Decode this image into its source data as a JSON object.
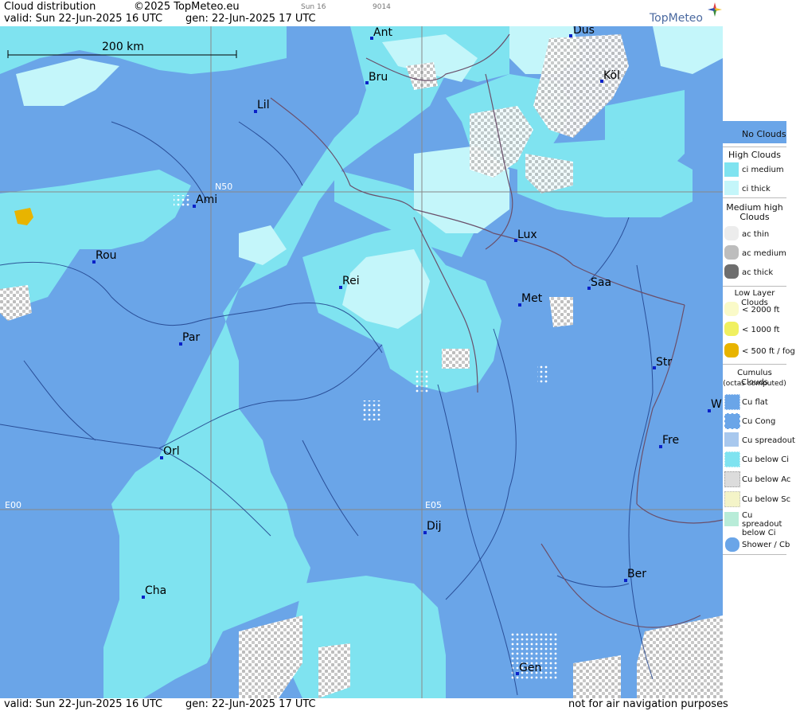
{
  "header": {
    "title": "Cloud distribution",
    "copyright": "©2025 TopMeteo.eu",
    "run_label": "Sun 16",
    "code": "9014",
    "valid": "valid:  Sun  22-Jun-2025  16 UTC",
    "gen": "gen: 22-Jun-2025 17 UTC",
    "brand": "TopMeteo"
  },
  "footer": {
    "valid": "valid:  Sun  22-Jun-2025  16 UTC",
    "gen": "gen: 22-Jun-2025 17 UTC",
    "disclaimer": "not for air navigation purposes"
  },
  "map": {
    "scale_label": "200 km",
    "coords": {
      "n50": "N50",
      "e00": "E00",
      "e05": "E05"
    },
    "cities": [
      {
        "name": "Ant"
      },
      {
        "name": "Düs"
      },
      {
        "name": "Bru"
      },
      {
        "name": "Köl"
      },
      {
        "name": "Lil"
      },
      {
        "name": "Ami"
      },
      {
        "name": "Lux"
      },
      {
        "name": "Rou"
      },
      {
        "name": "Rei"
      },
      {
        "name": "Saa"
      },
      {
        "name": "Met"
      },
      {
        "name": "Par"
      },
      {
        "name": "Str"
      },
      {
        "name": "W"
      },
      {
        "name": "Fre"
      },
      {
        "name": "Orl"
      },
      {
        "name": "Dij"
      },
      {
        "name": "Ber"
      },
      {
        "name": "Cha"
      },
      {
        "name": "Gen"
      }
    ]
  },
  "legend": {
    "no_clouds": "No Clouds",
    "high_head": "High Clouds",
    "ci_medium": "ci medium",
    "ci_thick": "ci thick",
    "med_head": "Medium high Clouds",
    "ac_thin": "ac thin",
    "ac_medium": "ac medium",
    "ac_thick": "ac thick",
    "low_head": "Low Layer Clouds",
    "low_2000": "< 2000 ft",
    "low_1000": "< 1000 ft",
    "low_500": "< 500 ft / fog",
    "cu_head": "Cumulus Clouds",
    "cu_sub": "(octas computed)",
    "cu_flat": "Cu flat",
    "cu_cong": "Cu Cong",
    "cu_spread": "Cu spreadout",
    "cu_below_ci": "Cu below Ci",
    "cu_below_ac": "Cu below Ac",
    "cu_below_sc": "Cu below Sc",
    "cu_spread_ci": "Cu spreadout below Ci",
    "shower": "Shower / Cb"
  },
  "colors": {
    "no_clouds": "#6aa5e8",
    "ci_medium": "#7fe3f0",
    "ci_thick": "#c4f6fa",
    "ac": "#c8c8c8",
    "low_fog": "#e8b400",
    "border": "#6a4f6a"
  }
}
